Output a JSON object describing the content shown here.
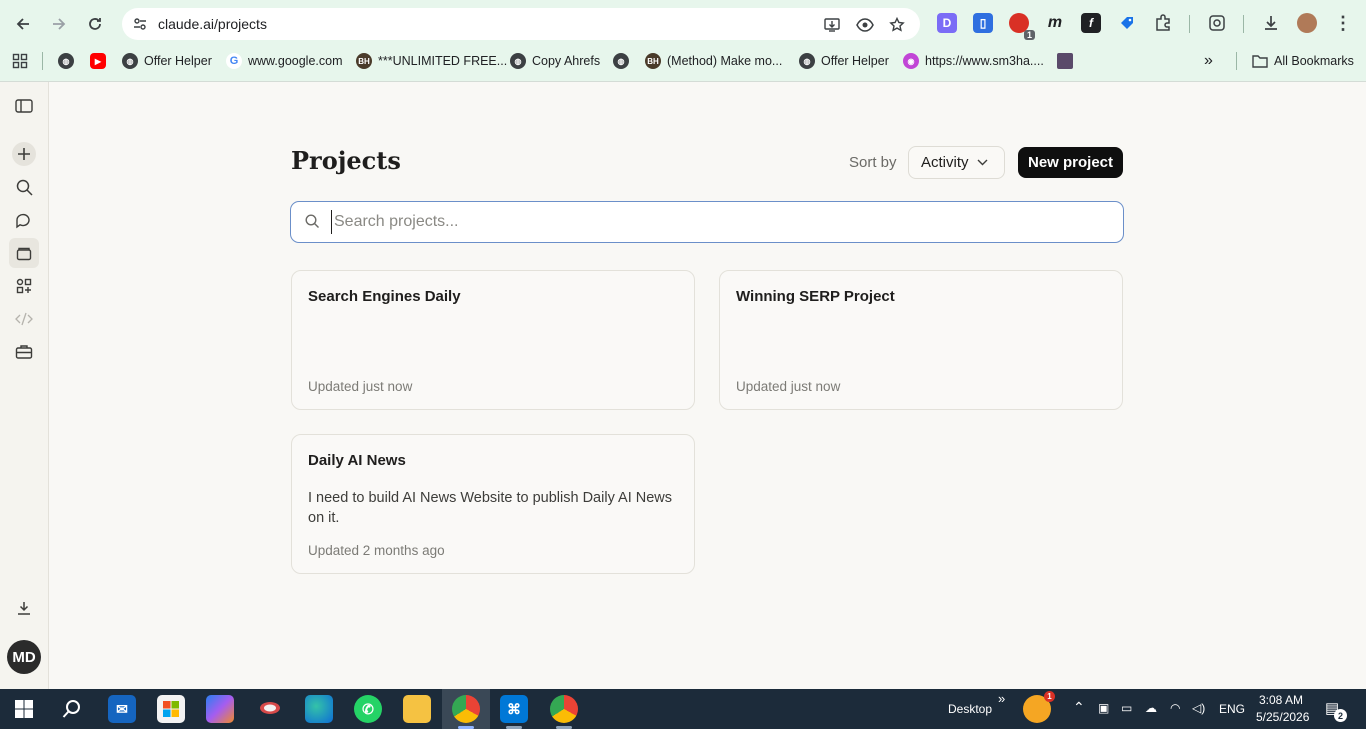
{
  "browser": {
    "url": "claude.ai/projects",
    "bookmarks": [
      {
        "label": "",
        "icon": "globe-icon"
      },
      {
        "label": "",
        "icon": "youtube-icon"
      },
      {
        "label": "Offer Helper",
        "icon": "globe-icon"
      },
      {
        "label": "www.google.com",
        "icon": "google-icon"
      },
      {
        "label": "***UNLIMITED FREE...",
        "icon": "bhw-icon"
      },
      {
        "label": "Copy Ahrefs",
        "icon": "globe-icon"
      },
      {
        "label": "",
        "icon": "globe-icon"
      },
      {
        "label": "(Method) Make mo...",
        "icon": "bhw-icon"
      },
      {
        "label": "Offer Helper",
        "icon": "globe-icon"
      },
      {
        "label": "https://www.sm3ha....",
        "icon": "site-icon"
      }
    ],
    "all_bookmarks_label": "All Bookmarks",
    "extension_badge": "1"
  },
  "sidebar": {
    "avatar_initials": "MD"
  },
  "main": {
    "title": "Projects",
    "sort_label": "Sort by",
    "sort_value": "Activity",
    "new_project_label": "New project",
    "search_placeholder": "Search projects...",
    "projects": [
      {
        "title": "Search Engines Daily",
        "description": "",
        "updated": "Updated just now"
      },
      {
        "title": "Winning SERP Project",
        "description": "",
        "updated": "Updated just now"
      },
      {
        "title": "Daily AI News",
        "description": "I need to build AI News Website to publish Daily AI News on it.",
        "updated": "Updated 2 months ago"
      }
    ]
  },
  "taskbar": {
    "desktop_label": "Desktop",
    "weather_badge": "1",
    "language": "ENG",
    "time": "3:08 AM",
    "date": "5/25/2026",
    "notification_count": "2"
  },
  "colors": {
    "browser_chrome": "#e7f6ec",
    "page_bg": "#f9f8f5",
    "primary_button": "#0f0f0f",
    "search_focus_border": "#6b8fc9",
    "taskbar_bg": "#1c2b3a"
  }
}
